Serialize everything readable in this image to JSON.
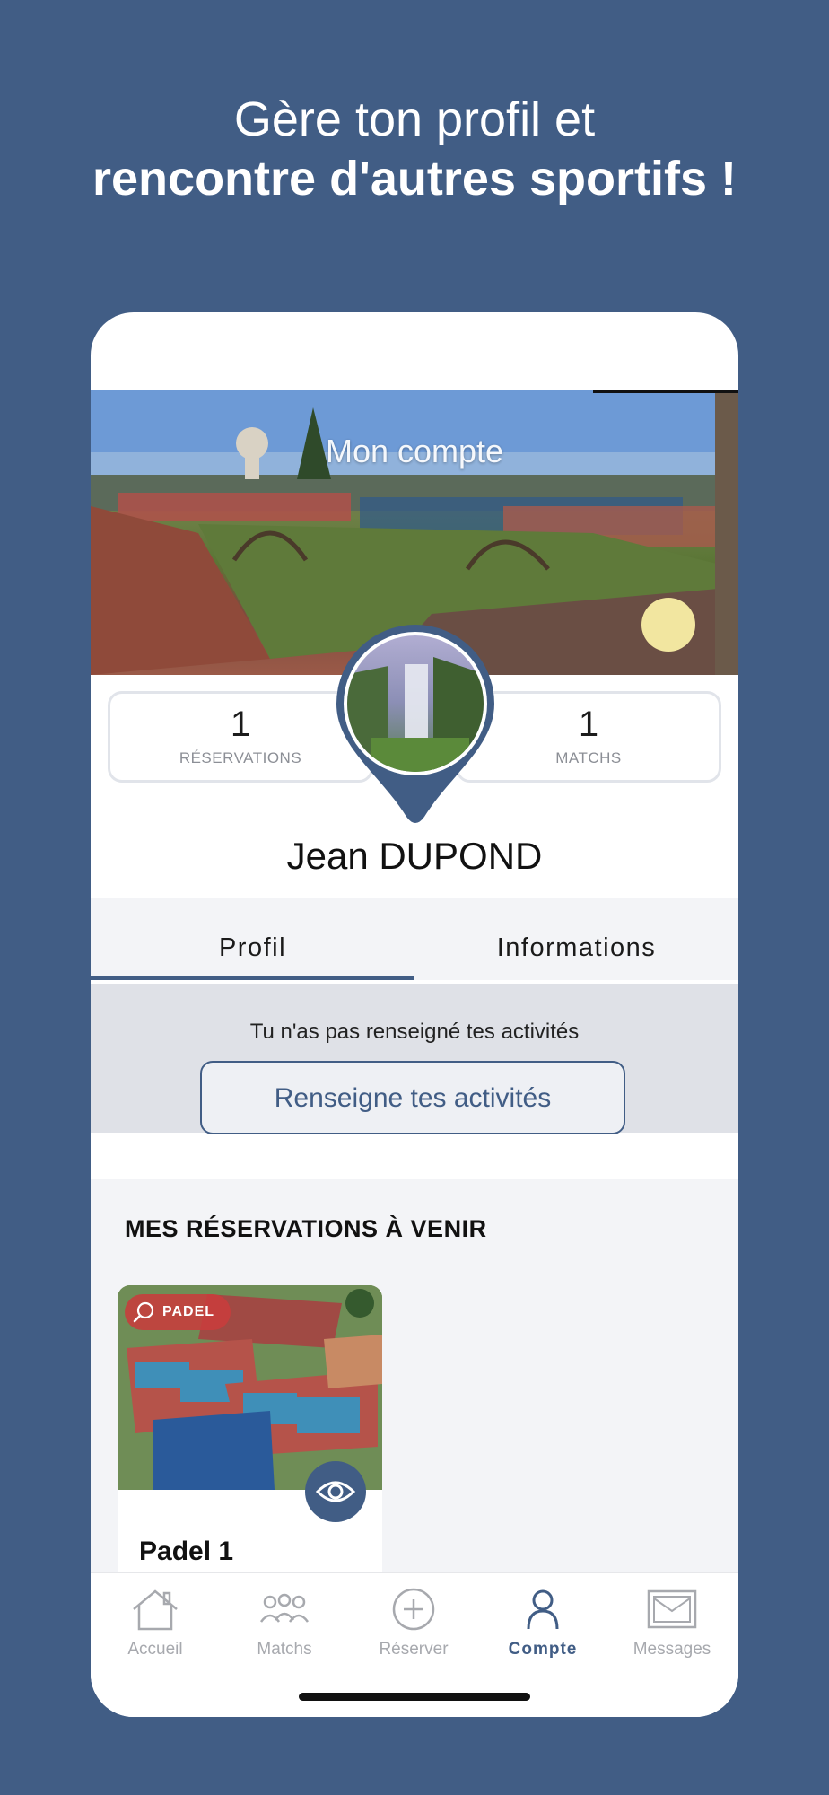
{
  "banner": {
    "line1": "Gère ton profil et",
    "line2": "rencontre d'autres sportifs !"
  },
  "header": {
    "title": "Mon compte"
  },
  "stats": {
    "reservations_count": "1",
    "reservations_label": "RÉSERVATIONS",
    "matchs_count": "1",
    "matchs_label": "MATCHS"
  },
  "user": {
    "full_name": "Jean  DUPOND"
  },
  "tabs": [
    {
      "label": "Profil",
      "active": true
    },
    {
      "label": "Informations",
      "active": false
    }
  ],
  "activities": {
    "message": "Tu n'as pas renseigné tes activités",
    "button_label": "Renseigne tes activités"
  },
  "reservations": {
    "heading": "MES RÉSERVATIONS À VENIR",
    "items": [
      {
        "sport_tag": "PADEL",
        "title": "Padel 1",
        "icon": "eye-icon"
      }
    ]
  },
  "navbar": {
    "items": [
      {
        "label": "Accueil",
        "icon": "home-icon",
        "active": false
      },
      {
        "label": "Matchs",
        "icon": "people-icon",
        "active": false
      },
      {
        "label": "Réserver",
        "icon": "plus-circle-icon",
        "active": false
      },
      {
        "label": "Compte",
        "icon": "user-icon",
        "active": true
      },
      {
        "label": "Messages",
        "icon": "mail-icon",
        "active": false
      }
    ]
  },
  "colors": {
    "brand": "#415d85",
    "tag_red": "#c83c3c",
    "inactive_nav": "#a7a9ae"
  }
}
